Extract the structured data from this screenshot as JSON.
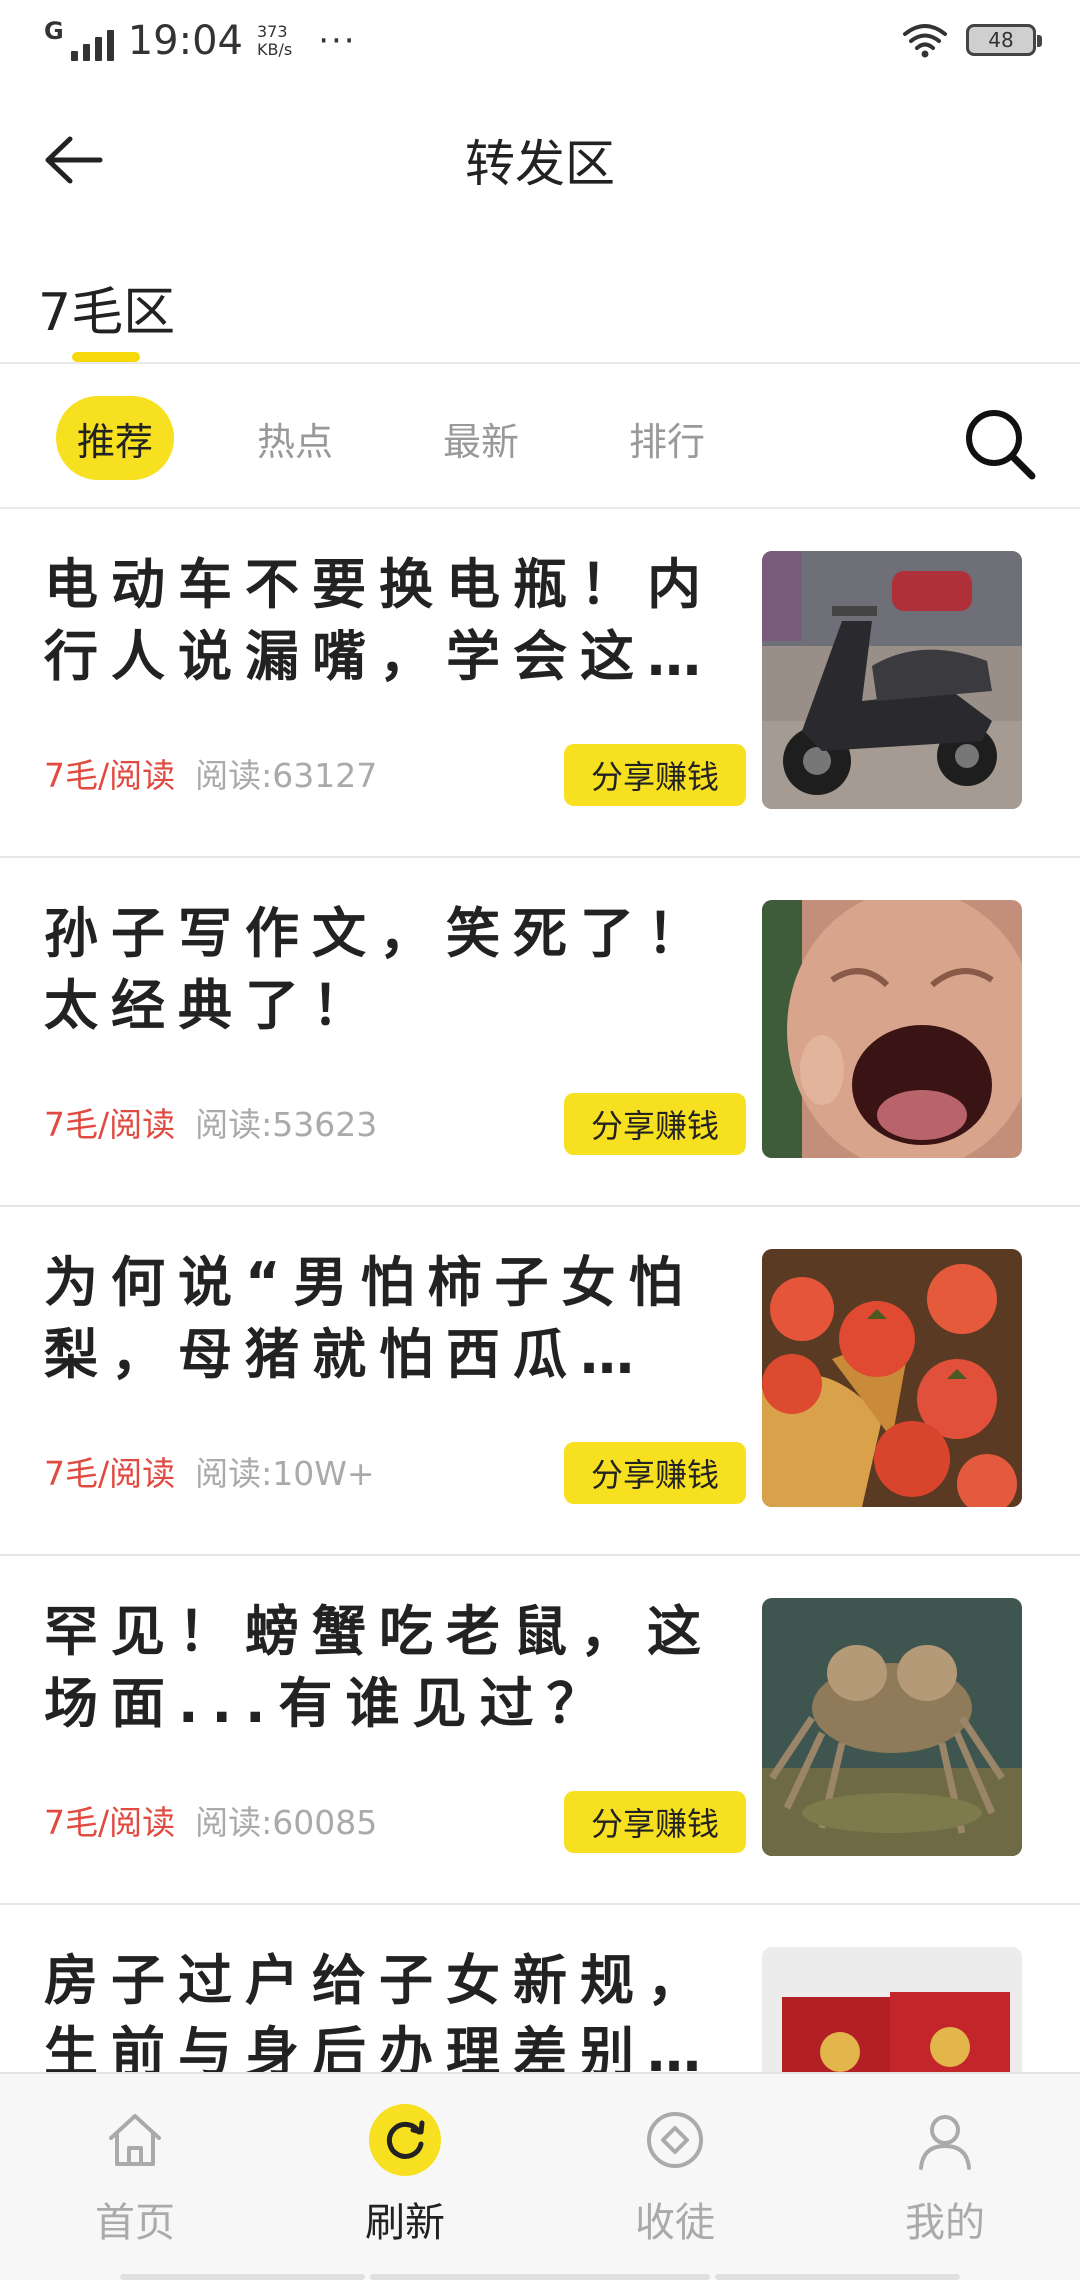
{
  "status_bar": {
    "network": "G",
    "time": "19:04",
    "speed_value": "373",
    "speed_unit": "KB/s",
    "more": "···",
    "battery": "48"
  },
  "header": {
    "back_icon": "arrow-left-icon",
    "title": "转发区"
  },
  "zone_tab": {
    "label": "7毛区",
    "accent": "#f5d90a"
  },
  "categories": {
    "tabs": [
      {
        "label": "推荐",
        "active": true
      },
      {
        "label": "热点",
        "active": false
      },
      {
        "label": "最新",
        "active": false
      },
      {
        "label": "排行",
        "active": false
      }
    ],
    "search_icon": "search-icon"
  },
  "articles": [
    {
      "title": "电动车不要换电瓶！内行人说漏嘴，学会这…",
      "price": "7毛/阅读",
      "reads": "阅读:63127",
      "share": "分享赚钱",
      "thumb": "scooter-photo"
    },
    {
      "title": "孙子写作文，笑死了！太经典了！",
      "price": "7毛/阅读",
      "reads": "阅读:53623",
      "share": "分享赚钱",
      "thumb": "crying-baby-photo"
    },
    {
      "title": "为何说“男怕柿子女怕梨，母猪就怕西瓜…",
      "price": "7毛/阅读",
      "reads": "阅读:10W+",
      "share": "分享赚钱",
      "thumb": "persimmon-photo"
    },
    {
      "title": "罕见！螃蟹吃老鼠，这场面...有谁见过？",
      "price": "7毛/阅读",
      "reads": "阅读:60085",
      "share": "分享赚钱",
      "thumb": "crab-photo"
    },
    {
      "title": "房子过户给子女新规，生前与身后办理差别…",
      "price": "",
      "reads": "",
      "share": "",
      "thumb": "property-certificate-photo"
    }
  ],
  "bottom_nav": {
    "items": [
      {
        "label": "首页",
        "icon": "home-icon",
        "active": false
      },
      {
        "label": "刷新",
        "icon": "refresh-icon",
        "active": true
      },
      {
        "label": "收徒",
        "icon": "diamond-icon",
        "active": false
      },
      {
        "label": "我的",
        "icon": "user-icon",
        "active": false
      }
    ]
  },
  "colors": {
    "accent_yellow": "#f7e020",
    "price_red": "#e04a40",
    "muted_gray": "#aaaaaa"
  }
}
